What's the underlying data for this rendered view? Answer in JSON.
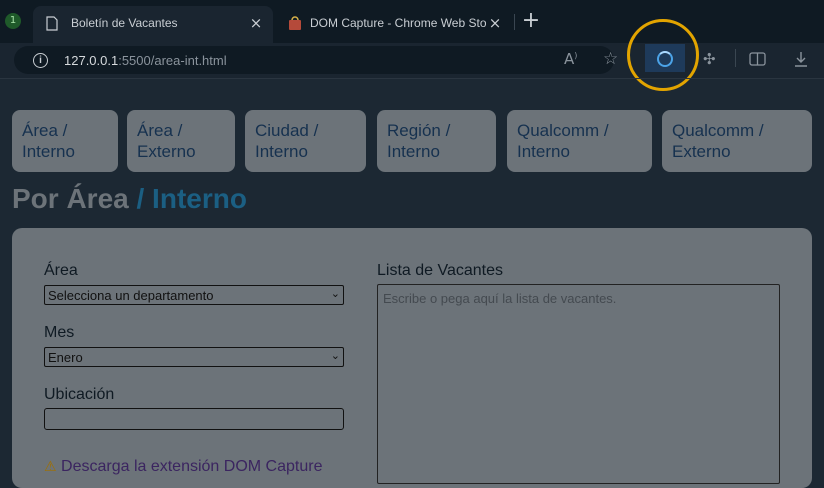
{
  "browser": {
    "tabs": [
      {
        "title": "Boletín de Vacantes",
        "active": true
      },
      {
        "title": "DOM Capture - Chrome Web Sto",
        "active": false
      }
    ],
    "workspace_badge": "1",
    "address": {
      "host": "127.0.0.1",
      "rest": ":5500/area-int.html"
    },
    "new_tab_glyph": "+",
    "close_glyph": "×"
  },
  "nav": {
    "buttons": [
      {
        "line1": "Área /",
        "line2": "Interno"
      },
      {
        "line1": "Área /",
        "line2": "Externo"
      },
      {
        "line1": "Ciudad /",
        "line2": "Interno"
      },
      {
        "line1": "Región /",
        "line2": "Interno"
      },
      {
        "line1": "Qualcomm /",
        "line2": "Interno"
      },
      {
        "line1": "Qualcomm /",
        "line2": "Externo"
      }
    ]
  },
  "heading": {
    "main": "Por Área",
    "sub": "/ Interno"
  },
  "form": {
    "area_label": "Área",
    "area_value": "Selecciona un departamento",
    "month_label": "Mes",
    "month_value": "Enero",
    "location_label": "Ubicación",
    "location_value": "",
    "list_label": "Lista de Vacantes",
    "list_placeholder": "Escribe o pega aquí la lista de vacantes.",
    "warning_text": "Descarga la extensión DOM Capture"
  },
  "colors": {
    "highlight": "#e2a400",
    "accent": "#1b5f83",
    "extension": "#4ba3e8"
  }
}
